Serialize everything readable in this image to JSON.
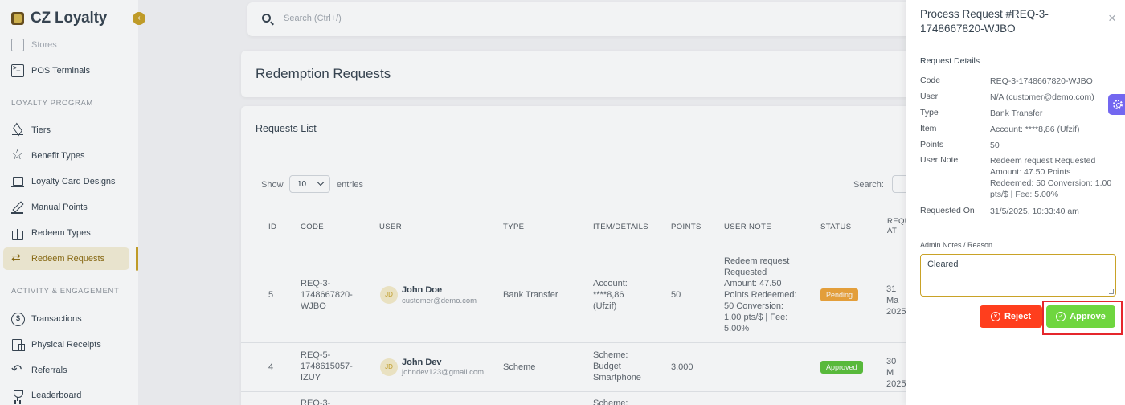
{
  "brand": {
    "name": "CZ Loyalty"
  },
  "sidebar": {
    "items_top": [
      {
        "label": "Stores",
        "icon": "store-icon"
      },
      {
        "label": "POS Terminals",
        "icon": "terminal-icon"
      }
    ],
    "section_loyalty": "LOYALTY PROGRAM",
    "items_loyalty": [
      {
        "label": "Tiers",
        "icon": "layers-icon"
      },
      {
        "label": "Benefit Types",
        "icon": "star-icon"
      },
      {
        "label": "Loyalty Card Designs",
        "icon": "card-icon"
      },
      {
        "label": "Manual Points",
        "icon": "pen-icon"
      },
      {
        "label": "Redeem Types",
        "icon": "gift-icon"
      },
      {
        "label": "Redeem Requests",
        "icon": "swap-icon",
        "active": true
      }
    ],
    "section_activity": "ACTIVITY & ENGAGEMENT",
    "items_activity": [
      {
        "label": "Transactions",
        "icon": "dollar-icon"
      },
      {
        "label": "Physical Receipts",
        "icon": "receipt-icon"
      },
      {
        "label": "Referrals",
        "icon": "share-icon"
      },
      {
        "label": "Leaderboard",
        "icon": "trophy-icon"
      }
    ]
  },
  "search": {
    "placeholder": "Search (Ctrl+/)"
  },
  "page": {
    "title": "Redemption Requests"
  },
  "list": {
    "title": "Requests List",
    "show_label": "Show",
    "entries_value": "10",
    "entries_label": "entries",
    "search_label": "Search:",
    "columns": [
      "ID",
      "CODE",
      "USER",
      "TYPE",
      "ITEM/DETAILS",
      "POINTS",
      "USER NOTE",
      "STATUS",
      "REQU AT"
    ],
    "rows": [
      {
        "id": "5",
        "code": "REQ-3-1748667820-WJBO",
        "avatar": "JD",
        "user_name": "John Doe",
        "user_email": "customer@demo.com",
        "type": "Bank Transfer",
        "item": "Account: ****8,86 (Ufzif)",
        "points": "50",
        "note": "Redeem request Requested Amount: 47.50 Points Redeemed: 50 Conversion: 1.00 pts/$ | Fee: 5.00%",
        "status": "Pending",
        "requested": "31 Ma 2025"
      },
      {
        "id": "4",
        "code": "REQ-5-1748615057-IZUY",
        "avatar": "JD",
        "user_name": "John Dev",
        "user_email": "johndev123@gmail.com",
        "type": "Scheme",
        "item": "Scheme: Budget Smartphone",
        "points": "3,000",
        "note": "",
        "status": "Approved",
        "requested": "30 M 2025"
      },
      {
        "code": "REQ-3-",
        "item": "Scheme:"
      }
    ]
  },
  "panel": {
    "title": "Process Request #REQ-3-1748667820-WJBO",
    "section": "Request Details",
    "details": [
      {
        "label": "Code",
        "value": "REQ-3-1748667820-WJBO"
      },
      {
        "label": "User",
        "value": "N/A (customer@demo.com)"
      },
      {
        "label": "Type",
        "value": "Bank Transfer"
      },
      {
        "label": "Item",
        "value": "Account: ****8,86 (Ufzif)"
      },
      {
        "label": "Points",
        "value": "50"
      },
      {
        "label": "User Note",
        "value": "Redeem request Requested Amount: 47.50 Points Redeemed: 50 Conversion: 1.00 pts/$ | Fee: 5.00%"
      },
      {
        "label": "Requested On",
        "value": "31/5/2025, 10:33:40 am"
      }
    ],
    "notes_label": "Admin Notes / Reason",
    "notes_value": "Cleared",
    "reject_label": "Reject",
    "approve_label": "Approve"
  },
  "colors": {
    "accent": "#c9a227",
    "pending": "#f0a53a",
    "approved": "#5cc23b",
    "reject": "#ff3e1d",
    "approve": "#6fd63f",
    "settings": "#7367f0"
  }
}
